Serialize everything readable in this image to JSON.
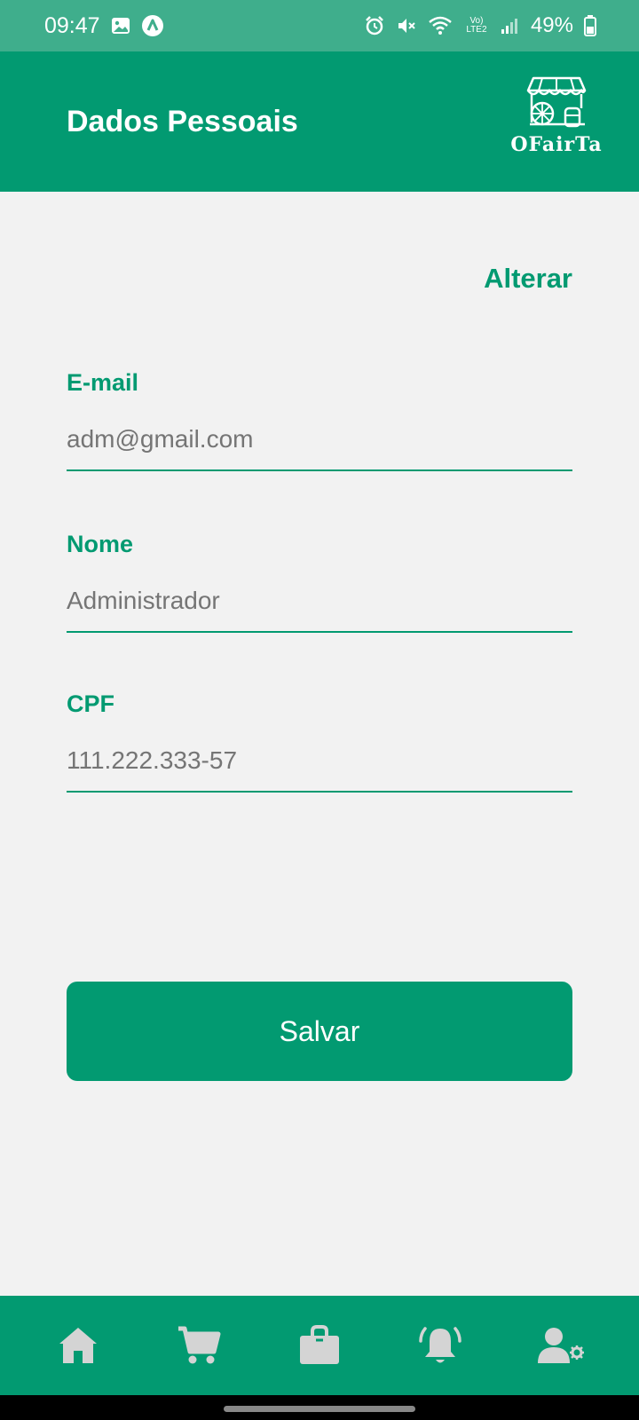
{
  "status_bar": {
    "time": "09:47",
    "battery_percent": "49%",
    "network_label": "Vo) LTE2",
    "icons": [
      "image-icon",
      "app-notification-icon",
      "alarm-icon",
      "mute-icon",
      "wifi-icon",
      "signal-icon",
      "battery-icon"
    ]
  },
  "header": {
    "title": "Dados Pessoais",
    "logo_text": "OFairTa"
  },
  "actions": {
    "edit_label": "Alterar",
    "save_label": "Salvar"
  },
  "fields": {
    "email": {
      "label": "E-mail",
      "placeholder": "adm@gmail.com"
    },
    "name": {
      "label": "Nome",
      "placeholder": "Administrador"
    },
    "cpf": {
      "label": "CPF",
      "placeholder": "111.222.333-57"
    }
  },
  "bottom_nav": {
    "items": [
      "home-icon",
      "cart-icon",
      "shopping-bag-icon",
      "notifications-bell-icon",
      "user-settings-icon"
    ]
  },
  "colors": {
    "primary": "#029a71",
    "status_bar": "#3fae8c",
    "background": "#f2f2f2",
    "nav_icon": "#d4d4d4",
    "placeholder": "#b0b0b0"
  }
}
